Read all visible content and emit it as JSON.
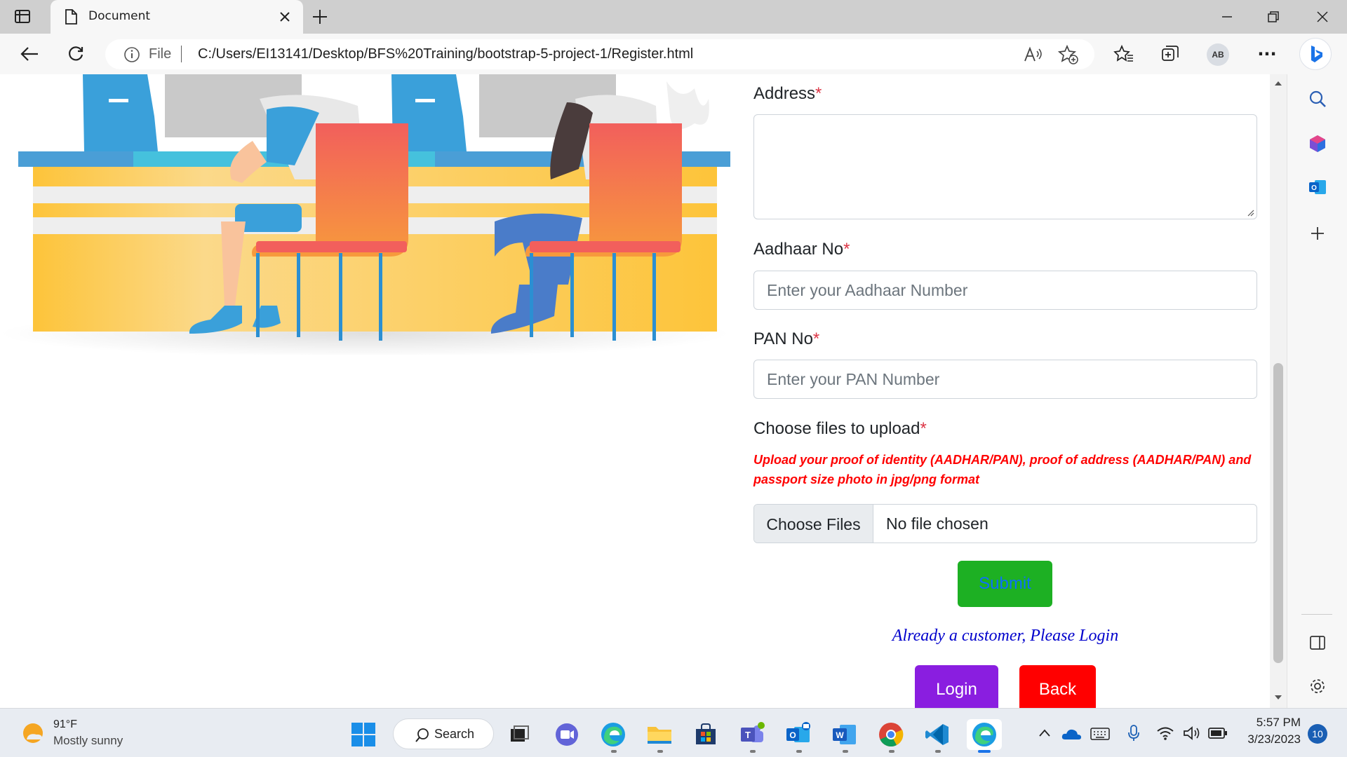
{
  "browser": {
    "tab_title": "Document",
    "address_scheme": "File",
    "url": "C:/Users/EI13141/Desktop/BFS%20Training/bootstrap-5-project-1/Register.html",
    "profile_initials": "AB",
    "more_label": "···"
  },
  "form": {
    "address_label": "Address",
    "aadhaar_label": "Aadhaar No",
    "aadhaar_placeholder": "Enter your Aadhaar Number",
    "pan_label": "PAN No",
    "pan_placeholder": "Enter your PAN Number",
    "upload_label": "Choose files to upload",
    "required_mark": "*",
    "upload_note": "Upload your proof of identity (AADHAR/PAN), proof of address (AADHAR/PAN) and passport size photo in jpg/png format",
    "choose_files_button": "Choose Files",
    "file_status": "No file chosen",
    "submit_label": "Submit",
    "already_customer": "Already a customer, Please Login",
    "login_label": "Login",
    "back_label": "Back"
  },
  "colors": {
    "submit_bg": "#1db023",
    "submit_text": "#0d6efd",
    "login_bg": "#8a1ee0",
    "back_bg": "#ff0000",
    "required": "#dc3545",
    "note": "#ff0000",
    "link": "#0000cc"
  },
  "taskbar": {
    "weather_temp": "91°F",
    "weather_desc": "Mostly sunny",
    "search_label": "Search",
    "time": "5:57 PM",
    "date": "3/23/2023",
    "notification_count": "10"
  }
}
